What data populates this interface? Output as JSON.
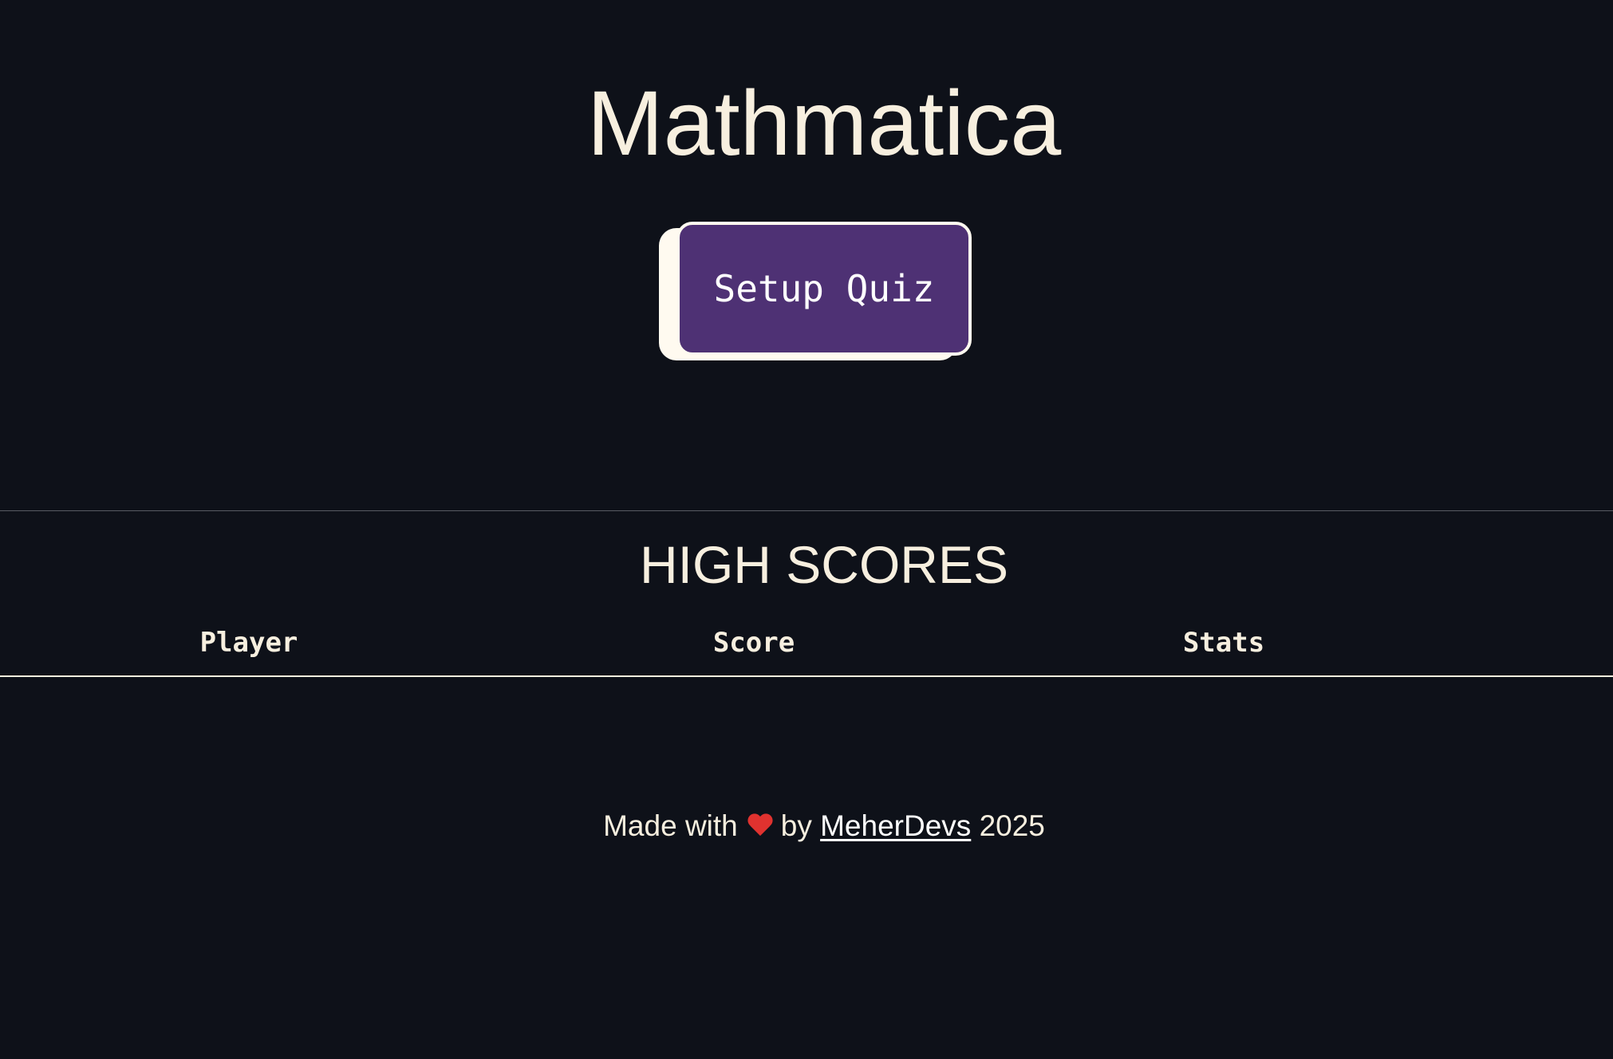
{
  "header": {
    "title": "Mathmatica"
  },
  "actions": {
    "setup_label": "Setup Quiz"
  },
  "high_scores": {
    "title": "HIGH SCORES",
    "columns": [
      "Player",
      "Score",
      "Stats"
    ],
    "rows": []
  },
  "footer": {
    "prefix": "Made with",
    "icon": "heart-icon",
    "by": "by",
    "author_link": "MeherDevs",
    "year": "2025"
  },
  "colors": {
    "background": "#0e1119",
    "text": "#f7efdf",
    "button": "#4e3174",
    "button_border": "#fffaf0",
    "heart": "#e0322f"
  }
}
